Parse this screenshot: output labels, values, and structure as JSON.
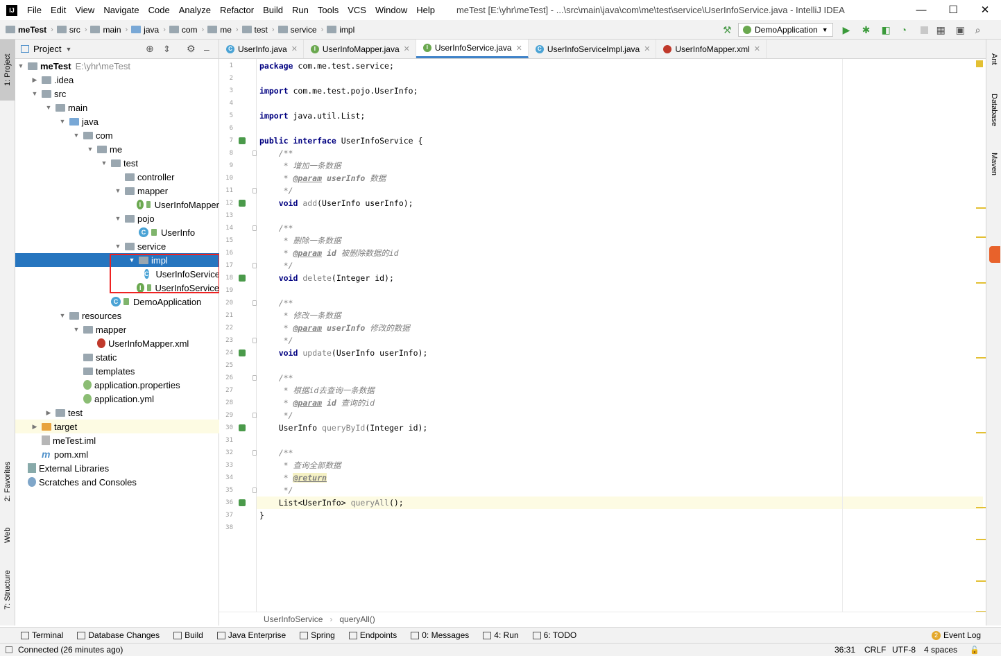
{
  "window": {
    "title": "meTest [E:\\yhr\\meTest] - ...\\src\\main\\java\\com\\me\\test\\service\\UserInfoService.java - IntelliJ IDEA",
    "app_icon": "IJ"
  },
  "menu": [
    "File",
    "Edit",
    "View",
    "Navigate",
    "Code",
    "Analyze",
    "Refactor",
    "Build",
    "Run",
    "Tools",
    "VCS",
    "Window",
    "Help"
  ],
  "breadcrumbs": [
    "meTest",
    "src",
    "main",
    "java",
    "com",
    "me",
    "test",
    "service",
    "impl"
  ],
  "run_config": "DemoApplication",
  "left_tabs": [
    "1: Project",
    "2: Favorites",
    "Web",
    "7: Structure"
  ],
  "right_tabs": [
    "Ant",
    "Database",
    "Maven"
  ],
  "project": {
    "header": "Project",
    "tree": [
      {
        "label": "meTest",
        "extra": "E:\\yhr\\meTest",
        "depth": 0,
        "arrow": "▼",
        "icon": "folder",
        "bold": true
      },
      {
        "label": ".idea",
        "depth": 0,
        "arrow": "▶",
        "icon": "folder",
        "indent": 1
      },
      {
        "label": "src",
        "depth": 0,
        "arrow": "▼",
        "icon": "folder",
        "indent": 1
      },
      {
        "label": "main",
        "arrow": "▼",
        "icon": "folder",
        "indent": 2
      },
      {
        "label": "java",
        "arrow": "▼",
        "icon": "folder-blue",
        "indent": 3
      },
      {
        "label": "com",
        "arrow": "▼",
        "icon": "package",
        "indent": 4
      },
      {
        "label": "me",
        "arrow": "▼",
        "icon": "package",
        "indent": 5
      },
      {
        "label": "test",
        "arrow": "▼",
        "icon": "package",
        "indent": 6
      },
      {
        "label": "controller",
        "arrow": "",
        "icon": "package",
        "indent": 7
      },
      {
        "label": "mapper",
        "arrow": "▼",
        "icon": "package",
        "indent": 7
      },
      {
        "label": "UserInfoMapper",
        "arrow": "",
        "icon": "interface",
        "indent": 8
      },
      {
        "label": "pojo",
        "arrow": "▼",
        "icon": "package",
        "indent": 7
      },
      {
        "label": "UserInfo",
        "arrow": "",
        "icon": "class",
        "indent": 8
      },
      {
        "label": "service",
        "arrow": "▼",
        "icon": "package",
        "indent": 7
      },
      {
        "label": "impl",
        "arrow": "▼",
        "icon": "package",
        "indent": 8,
        "selected": true
      },
      {
        "label": "UserInfoServiceImpl",
        "arrow": "",
        "icon": "class",
        "indent": 9
      },
      {
        "label": "UserInfoService",
        "arrow": "",
        "icon": "interface",
        "indent": 8
      },
      {
        "label": "DemoApplication",
        "arrow": "",
        "icon": "spring-class",
        "indent": 6
      },
      {
        "label": "resources",
        "arrow": "▼",
        "icon": "folder",
        "indent": 3
      },
      {
        "label": "mapper",
        "arrow": "▼",
        "icon": "folder",
        "indent": 4
      },
      {
        "label": "UserInfoMapper.xml",
        "arrow": "",
        "icon": "xml",
        "indent": 5
      },
      {
        "label": "static",
        "arrow": "",
        "icon": "folder",
        "indent": 4
      },
      {
        "label": "templates",
        "arrow": "",
        "icon": "folder",
        "indent": 4
      },
      {
        "label": "application.properties",
        "arrow": "",
        "icon": "prop",
        "indent": 4
      },
      {
        "label": "application.yml",
        "arrow": "",
        "icon": "prop",
        "indent": 4
      },
      {
        "label": "test",
        "arrow": "▶",
        "icon": "folder",
        "indent": 2
      },
      {
        "label": "target",
        "arrow": "▶",
        "icon": "folder-orange",
        "indent": 1,
        "highlight": true
      },
      {
        "label": "meTest.iml",
        "arrow": "",
        "icon": "file",
        "indent": 1
      },
      {
        "label": "pom.xml",
        "arrow": "",
        "icon": "maven",
        "indent": 1
      },
      {
        "label": "External Libraries",
        "arrow": "",
        "icon": "lib",
        "indent": 0
      },
      {
        "label": "Scratches and Consoles",
        "arrow": "",
        "icon": "scratch",
        "indent": 0
      }
    ]
  },
  "tabs": [
    {
      "label": "UserInfo.java",
      "kind": "C",
      "color": "#4aa3d5"
    },
    {
      "label": "UserInfoMapper.java",
      "kind": "I",
      "color": "#6aa84f"
    },
    {
      "label": "UserInfoService.java",
      "kind": "I",
      "color": "#6aa84f",
      "active": true
    },
    {
      "label": "UserInfoServiceImpl.java",
      "kind": "C",
      "color": "#4aa3d5"
    },
    {
      "label": "UserInfoMapper.xml",
      "kind": "X",
      "color": "#c0392b"
    }
  ],
  "code_lines": [
    "package com.me.test.service;",
    "",
    "import com.me.test.pojo.UserInfo;",
    "",
    "import java.util.List;",
    "",
    "public interface UserInfoService {",
    "    /**",
    "     * 增加一条数据",
    "     * @param userInfo 数据",
    "     */",
    "    void add(UserInfo userInfo);",
    "",
    "    /**",
    "     * 删除一条数据",
    "     * @param id 被删除数据的id",
    "     */",
    "    void delete(Integer id);",
    "",
    "    /**",
    "     * 修改一条数据",
    "     * @param userInfo 修改的数据",
    "     */",
    "    void update(UserInfo userInfo);",
    "",
    "    /**",
    "     * 根据id去查询一条数据",
    "     * @param id 查询的id",
    "     */",
    "    UserInfo queryById(Integer id);",
    "",
    "    /**",
    "     * 查询全部数据",
    "     * @return",
    "     */",
    "    List<UserInfo> queryAll();",
    "}",
    ""
  ],
  "gutter_marks": [
    7,
    12,
    18,
    24,
    30,
    36
  ],
  "editor_breadcrumb": [
    "UserInfoService",
    "queryAll()"
  ],
  "bottom_tools": [
    "Terminal",
    "Database Changes",
    "Build",
    "Java Enterprise",
    "Spring",
    "Endpoints",
    "0: Messages",
    "4: Run",
    "6: TODO"
  ],
  "event_log": {
    "count": "2",
    "label": "Event Log"
  },
  "status": {
    "message": "Connected (26 minutes ago)",
    "position": "36:31",
    "line_sep": "CRLF",
    "encoding": "UTF-8",
    "indent": "4 spaces"
  },
  "colors": {
    "accent": "#2675bf",
    "selection": "#2675bf",
    "keyword": "#000080",
    "comment": "#808080",
    "highlight_box": "#e22222"
  }
}
